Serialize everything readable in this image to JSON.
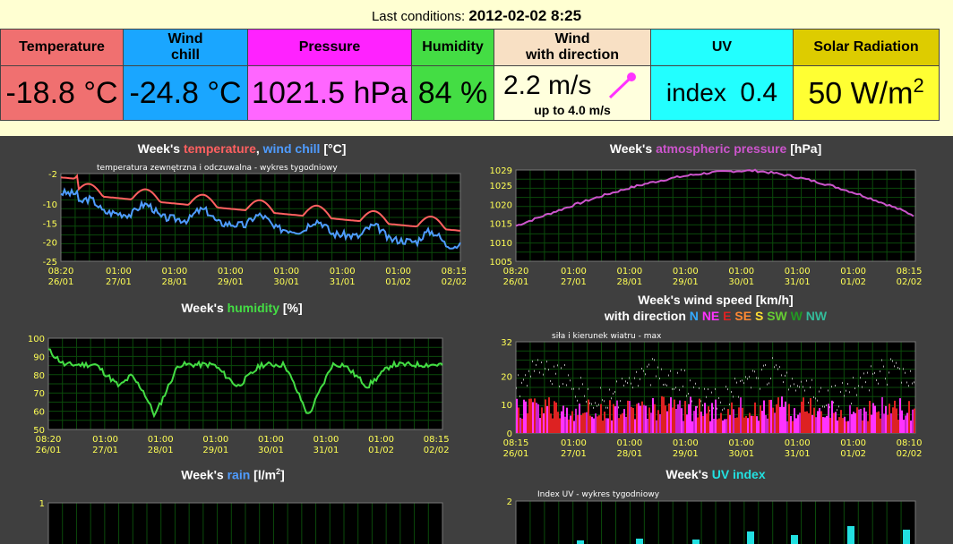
{
  "header": {
    "prefix": "Last conditions:",
    "datetime": "2012-02-02 8:25"
  },
  "cards": {
    "temperature": {
      "title": "Temperature",
      "value": "-18.8 °C",
      "bg": "#f07070"
    },
    "windchill": {
      "title1": "Wind",
      "title2": "chill",
      "value": "-24.8 °C",
      "bg": "#1aa6ff"
    },
    "pressure": {
      "title": "Pressure",
      "value": "1021.5 hPa",
      "bg": "#ff66ff"
    },
    "humidity": {
      "title": "Humidity",
      "value": "84 %",
      "bg": "#44dd44"
    },
    "wind": {
      "title1": "Wind",
      "title2": "with direction",
      "value": "2.2 m/s",
      "sub": "up to 4.0 m/s",
      "bg": "#ffffdd",
      "head_bg": "#f8e0c4"
    },
    "uv": {
      "title": "UV",
      "label": "index",
      "value": "0.4",
      "bg": "#22ffff"
    },
    "solar": {
      "title": "Solar Radiation",
      "value": "50 W/m",
      "sup": "2",
      "bg": "#ffff33",
      "head_bg": "#ddcc00"
    }
  },
  "panels": {
    "temp": {
      "pre": "Week's",
      "s1": "temperature",
      "sep": ",",
      "s2": "wind chill",
      "unit": "[°C]",
      "inner": "temperatura zewnętrzna i odczuwalna - wykres tygodniowy",
      "c1": "#ff6060",
      "c2": "#4f9cff"
    },
    "pressure": {
      "pre": "Week's",
      "s1": "atmospheric pressure",
      "unit": "[hPa]",
      "c1": "#cc55cc"
    },
    "humidity": {
      "pre": "Week's",
      "s1": "humidity",
      "unit": "[%]",
      "c1": "#44dd44"
    },
    "wind": {
      "pre": "Week's",
      "s1": "wind speed",
      "unit": "[km/h]",
      "line2": "with direction",
      "inner": "siła i kierunek wiatru - max",
      "dirs": [
        {
          "t": "N",
          "c": "#33aaff"
        },
        {
          "t": "NE",
          "c": "#ff33ff"
        },
        {
          "t": "E",
          "c": "#dd2222"
        },
        {
          "t": "SE",
          "c": "#ff8833"
        },
        {
          "t": "S",
          "c": "#ffdd33"
        },
        {
          "t": "SW",
          "c": "#66cc33"
        },
        {
          "t": "W",
          "c": "#229922"
        },
        {
          "t": "NW",
          "c": "#33bb99"
        }
      ]
    },
    "rain": {
      "pre": "Week's",
      "s1": "rain",
      "unit": "[l/m",
      "sup": "2",
      "unit2": "]",
      "c1": "#4f9cff"
    },
    "uv": {
      "pre": "Week's",
      "s1": "UV index",
      "inner": "Index UV - wykres tygodniowy",
      "c1": "#22e0e0"
    }
  },
  "axes": {
    "x_a": [
      "08:20\n26/01",
      "01:00\n27/01",
      "01:00\n28/01",
      "01:00\n29/01",
      "01:00\n30/01",
      "01:00\n31/01",
      "01:00\n01/02",
      "08:15\n02/02"
    ],
    "x_wind": [
      "08:15\n26/01",
      "01:00\n27/01",
      "01:00\n28/01",
      "01:00\n29/01",
      "01:00\n30/01",
      "01:00\n31/01",
      "01:00\n01/02",
      "08:10\n02/02"
    ],
    "y_temp": [
      "-2",
      "-10",
      "-15",
      "-20",
      "-25"
    ],
    "y_press": [
      "1029",
      "1025",
      "1020",
      "1015",
      "1010",
      "1005"
    ],
    "y_hum": [
      "100",
      "90",
      "80",
      "70",
      "60",
      "50"
    ],
    "y_wind": [
      "32",
      "20",
      "10",
      "0"
    ],
    "y_rain": [
      "1"
    ],
    "y_uv": [
      "2"
    ]
  }
}
